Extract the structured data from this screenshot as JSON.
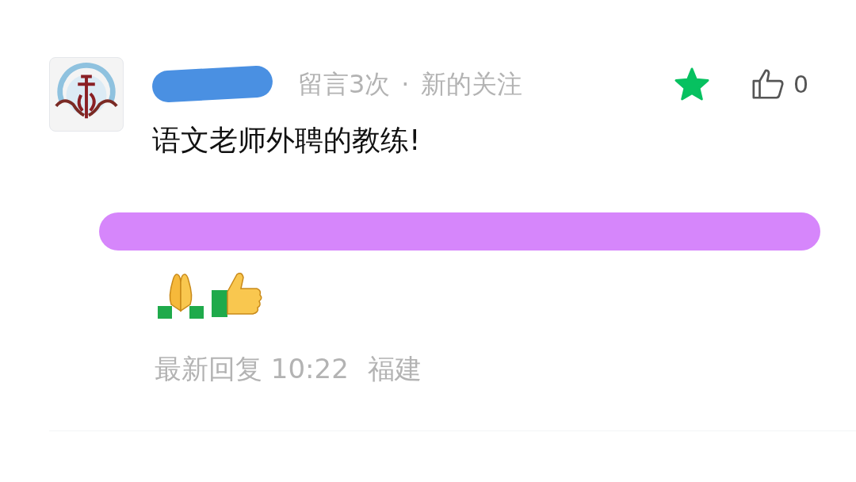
{
  "comment": {
    "author": {
      "redacted": true
    },
    "meta": [
      "留言3次",
      "·",
      "新的关注"
    ],
    "starred": true,
    "likes": "0",
    "text": "语文老师外聘的教练!",
    "reply": {
      "redacted": true
    },
    "footer": {
      "label": "最新回复",
      "time": "10:22",
      "location": "福建"
    }
  }
}
